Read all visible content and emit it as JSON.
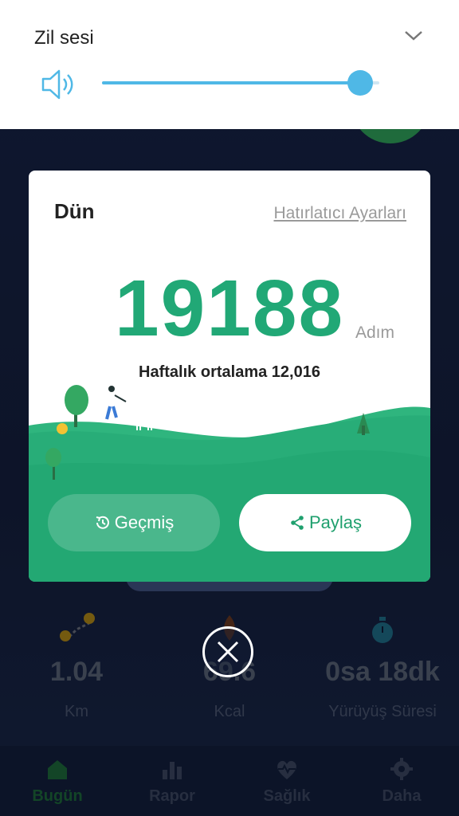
{
  "volume": {
    "title": "Zil sesi",
    "level_percent": 93
  },
  "card": {
    "title": "Dün",
    "reminder_link": "Hatırlatıcı Ayarları",
    "steps": "19188",
    "steps_unit": "Adım",
    "weekly_avg": "Haftalık ortalama 12,016",
    "history_label": "Geçmiş",
    "share_label": "Paylaş"
  },
  "stats": [
    {
      "value": "1.04",
      "label": "Km",
      "icon": "map-route-icon"
    },
    {
      "value": "69.6",
      "label": "Kcal",
      "icon": "flame-icon"
    },
    {
      "value": "0sa 18dk",
      "label": "Yürüyüş Süresi",
      "icon": "stopwatch-icon"
    }
  ],
  "nav": [
    {
      "label": "Bugün",
      "icon": "home-icon",
      "active": true
    },
    {
      "label": "Rapor",
      "icon": "bar-chart-icon",
      "active": false
    },
    {
      "label": "Sağlık",
      "icon": "heart-pulse-icon",
      "active": false
    },
    {
      "label": "Daha",
      "icon": "gear-icon",
      "active": false
    }
  ],
  "colors": {
    "accent": "#21a876",
    "slider": "#4fb8e6",
    "background": "#17254a"
  }
}
